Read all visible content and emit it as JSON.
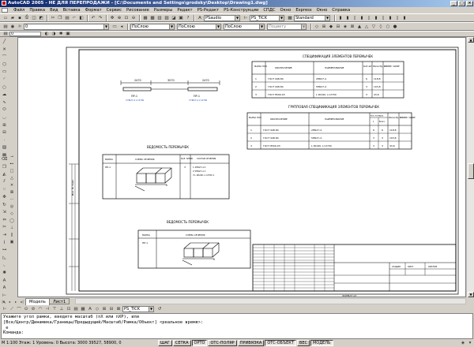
{
  "window": {
    "title": "AutoCAD 2005 - НЕ ДЛЯ ПЕРЕПРОДАЖИ - [C:\\Documents and Settings\\grodsky\\Desktop\\Drawing1.dwg]",
    "minimize": "_",
    "maximize": "□",
    "close": "×"
  },
  "menu": [
    "Файл",
    "Правка",
    "Вид",
    "Вставка",
    "Формат",
    "Сервис",
    "Рисование",
    "Размеры",
    "Редакт",
    "PS-Редакт",
    "PS-Конструкции",
    "СПДС",
    "Окно",
    "Express",
    "Окно",
    "Справка"
  ],
  "toolbar1": {
    "textstyle": "PSaudio",
    "dimstyle": "PS_TICK",
    "tablestyle": "Standard"
  },
  "toolbar2": {
    "layer": "0",
    "color": "ПоСлою",
    "linetype": "ПоСлою",
    "lineweight": "ПоСлою",
    "plotstyle": "Поцвету"
  },
  "toolbar3": {
    "layer_state": "0"
  },
  "layout_tabs": {
    "model": "Модель",
    "sheet1": "Лист1"
  },
  "strip": {
    "dimstyle": "PS_TICK"
  },
  "command": {
    "lines": [
      "Укажите угол рамки, введите масштаб (nX или nXP), или",
      "[Все/Центр/Динамика/Границы/Предыдущий/Масштаб/Рамка/Объект] <реальное время>:",
      "_e",
      "Команда:"
    ]
  },
  "status": {
    "coords": "М 1:100  Этаж: 1 Уровень: 0 Высота: 3000  39527, 58900, 0",
    "buttons": [
      "ШАГ",
      "СЕТКА",
      "ОРТО",
      "ОТС-ПОЛЯР",
      "ПРИВЯЗКА",
      "ОТС-ОБЪЕКТ",
      "ВЕС",
      "МОДЕЛЬ"
    ],
    "active": [
      "ОРТО",
      "ОТС-ОБЪЕКТ",
      "МОДЕЛЬ"
    ]
  },
  "drawing": {
    "beam": {
      "dims": [
        "2470",
        "3570",
        "2470"
      ],
      "label_left": "ПР-1",
      "label_left_sub": "3 ПБ27-4 L=2700",
      "label_right": "ПР-1",
      "label_right_sub": "3 ПБ27-4 L=2700"
    },
    "spec1": {
      "title": "СПЕЦИФИКАЦИЯ ЭЛЕМЕНТОВ ПЕРЕМЫЧЕК",
      "headers": [
        "МАРКА ПОЗ.",
        "ОБОЗНАЧЕНИЕ",
        "НАИМЕНОВАНИЕ",
        "КОЛ. ШТ.",
        "МАССА ЕД., КГ",
        "ПРИМЕ- ЧАНИЕ"
      ],
      "rows": [
        [
          "1",
          "ГОСТ 948-84",
          "2ПБ27-4",
          "6",
          "118,8",
          ""
        ],
        [
          "2",
          "ГОСТ 948-84",
          "5ПБ27-4",
          "3",
          "103,8",
          ""
        ],
        [
          "3",
          "ГОСТ 8509-93",
          "L 90х90, L=2700",
          "3",
          "43,6",
          ""
        ]
      ]
    },
    "spec2": {
      "title": "ГРУППОВАЯ СПЕЦИФИКАЦИЯ ЭЛЕМЕНТОВ ПЕРЕМЫЧЕК",
      "headers": [
        "МАРКА ПОЗ.",
        "ОБОЗНАЧЕНИЕ",
        "НАИМЕНОВАНИЕ",
        "Кол. на марку",
        "МАССА ЕД., КГ",
        "ПРИМЕ- ЧАНИЕ"
      ],
      "subheaders": [
        "1",
        "Всего"
      ],
      "rows": [
        [
          "1",
          "ГОСТ 948-84",
          "2ПБ27-4",
          "6",
          "6",
          "118,8",
          ""
        ],
        [
          "2",
          "ГОСТ 948-84",
          "5ПБ27-4",
          "3",
          "3",
          "103,8",
          ""
        ],
        [
          "3",
          "ГОСТ 8509-93",
          "L 90х90, L=2700",
          "3",
          "3",
          "43,6",
          ""
        ]
      ]
    },
    "ved1": {
      "title": "ВЕДОМОСТЬ ПЕРЕМЫЧЕК",
      "headers": [
        "МАРКА",
        "СХЕМА СЕЧЕНИЯ",
        "КОЛ. ТИПОВ",
        "СОСТАВ СЕЧЕНИЯ"
      ],
      "mark": "ПР-1",
      "count": "3",
      "composition": [
        "1  2ПБ27-4  2",
        "2  5ПБ27-4  1",
        "3  L 90х90, L=2700  1"
      ]
    },
    "ved2": {
      "title": "ВЕДОМОСТЬ ПЕРЕМЫЧЕК",
      "headers": [
        "МАРКА",
        "СХЕМА СЕЧЕНИЯ"
      ],
      "mark": "ПР-1"
    },
    "stamp": {
      "stage": "СТАДИЯ",
      "sheet": "ЛИСТ",
      "sheets": "ЛИСТОВ"
    },
    "sheet_format": "ФОРМАТ А3",
    "side_label": "Инв. № подл."
  },
  "colors": {
    "title_start": "#0a246a",
    "title_end": "#a6caf0",
    "chrome": "#d4d0c8"
  }
}
